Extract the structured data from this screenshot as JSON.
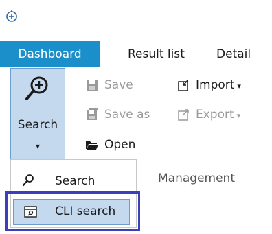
{
  "tabs": [
    {
      "label": "Dashboard",
      "active": true
    },
    {
      "label": "Result list",
      "active": false
    },
    {
      "label": "Detail",
      "active": false
    }
  ],
  "ribbon": {
    "search_button": {
      "label": "Search",
      "caret": "▾",
      "icon": "magnifier-plus-icon"
    },
    "save_label": "Save",
    "save_as_label": "Save as",
    "open_label": "Open",
    "import_label": "Import",
    "export_label": "Export",
    "group_label": "Management"
  },
  "dropdown": {
    "items": [
      {
        "label": "Search",
        "icon": "magnifier-icon"
      },
      {
        "label": "CLI search",
        "icon": "cli-window-icon",
        "highlighted": true
      }
    ]
  },
  "colors": {
    "tab_active_bg": "#1a8fc9",
    "selected_bg": "#c5d9ee",
    "selected_border": "#6e9ccf",
    "highlight_frame": "#3d3fba",
    "disabled_text": "#9a9a9a"
  }
}
